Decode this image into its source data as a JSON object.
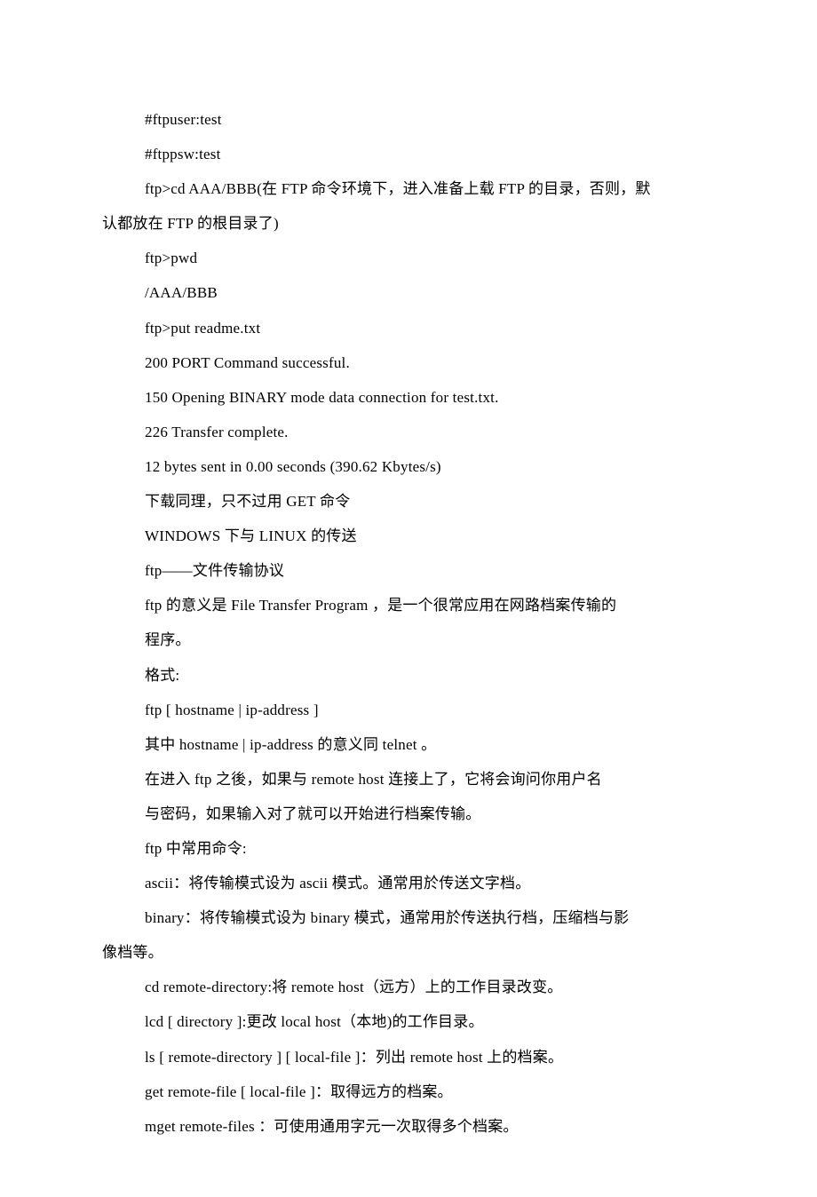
{
  "lines": [
    {
      "cls": "indent",
      "text": "#ftpuser:test"
    },
    {
      "cls": "indent",
      "text": "#ftppsw:test"
    },
    {
      "cls": "indent",
      "text": "ftp>cd AAA/BBB(在 FTP 命令环境下，进入准备上载 FTP 的目录，否则，默"
    },
    {
      "cls": "noindent",
      "text": "认都放在 FTP 的根目录了)"
    },
    {
      "cls": "indent",
      "text": "ftp>pwd"
    },
    {
      "cls": "indent",
      "text": "/AAA/BBB"
    },
    {
      "cls": "indent",
      "text": "ftp>put readme.txt"
    },
    {
      "cls": "indent",
      "text": "200 PORT Command successful."
    },
    {
      "cls": "indent",
      "text": "150 Opening BINARY mode data connection for test.txt."
    },
    {
      "cls": "indent",
      "text": "226 Transfer complete."
    },
    {
      "cls": "indent",
      "text": "12 bytes sent in 0.00 seconds (390.62 Kbytes/s)"
    },
    {
      "cls": "indent",
      "text": "下载同理，只不过用 GET 命令"
    },
    {
      "cls": "indent",
      "text": "WINDOWS 下与 LINUX 的传送"
    },
    {
      "cls": "indent",
      "text": "ftp——文件传输协议"
    },
    {
      "cls": "indent",
      "text": "ftp 的意义是 File Transfer Program ，是一个很常应用在网路档案传输的"
    },
    {
      "cls": "indent",
      "text": "程序。"
    },
    {
      "cls": "indent",
      "text": "格式:"
    },
    {
      "cls": "indent",
      "text": "ftp [ hostname | ip-address ]"
    },
    {
      "cls": "indent",
      "text": "其中 hostname | ip-address 的意义同 telnet 。"
    },
    {
      "cls": "indent",
      "text": "在进入 ftp 之後，如果与 remote host 连接上了，它将会询问你用户名"
    },
    {
      "cls": "indent",
      "text": "与密码，如果输入对了就可以开始进行档案传输。"
    },
    {
      "cls": "indent",
      "text": "ftp 中常用命令:"
    },
    {
      "cls": "indent",
      "text": "ascii：将传输模式设为 ascii 模式。通常用於传送文字档。"
    },
    {
      "cls": "indent",
      "text": "binary：将传输模式设为 binary 模式，通常用於传送执行档，压缩档与影"
    },
    {
      "cls": "noindent",
      "text": "像档等。"
    },
    {
      "cls": "indent",
      "text": "cd remote-directory:将 remote host（远方）上的工作目录改变。"
    },
    {
      "cls": "indent",
      "text": "lcd [ directory ]:更改 local host（本地)的工作目录。"
    },
    {
      "cls": "indent",
      "text": "ls [ remote-directory ] [ local-file ]：列出 remote host 上的档案。"
    },
    {
      "cls": "indent",
      "text": "get remote-file [ local-file ]：取得远方的档案。"
    },
    {
      "cls": "indent",
      "text": "mget remote-files ：可使用通用字元一次取得多个档案。"
    }
  ]
}
